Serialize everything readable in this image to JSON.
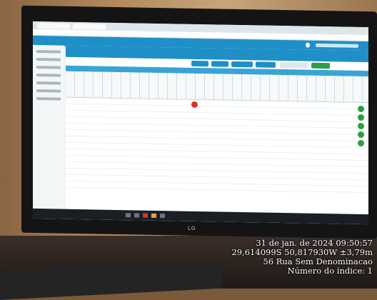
{
  "monitor": {
    "brand": "LG"
  },
  "photo_stamp": {
    "datetime": "31 de jan. de 2024 09:50:57",
    "coordinates": "29,614099S 50,817930W ±3,79m",
    "address": "56 Rua Sem Denominacao",
    "index": "Número do índice: 1"
  }
}
